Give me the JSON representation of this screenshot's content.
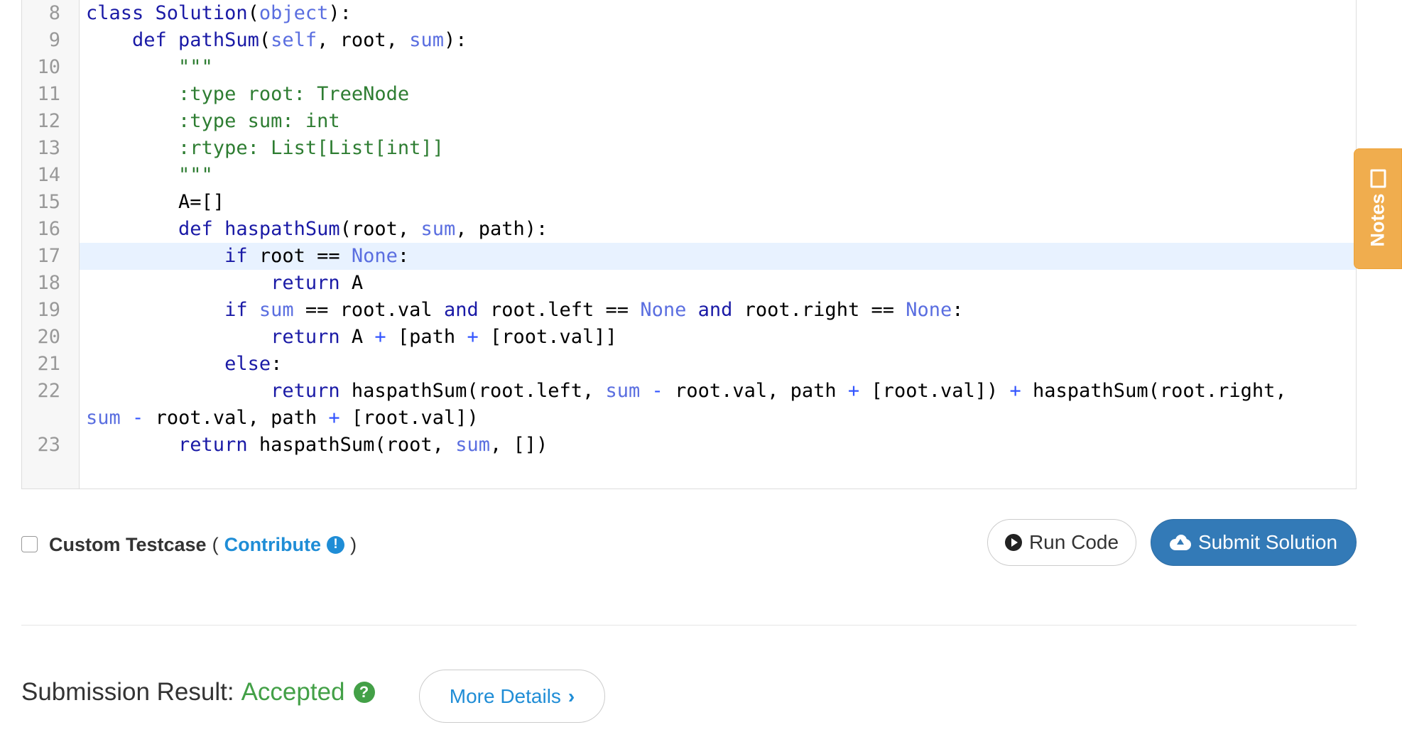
{
  "editor": {
    "lines": [
      {
        "num": "8",
        "segs": [
          [
            "class ",
            "kw"
          ],
          [
            "Solution",
            "kw"
          ],
          [
            "(",
            ""
          ],
          [
            "object",
            "vr"
          ],
          [
            "):",
            ""
          ]
        ]
      },
      {
        "num": "9",
        "segs": [
          [
            "    def ",
            "kw"
          ],
          [
            "pathSum",
            "kw"
          ],
          [
            "(",
            ""
          ],
          [
            "self",
            "vr"
          ],
          [
            ", root, ",
            ""
          ],
          [
            "sum",
            "vr"
          ],
          [
            "):",
            ""
          ]
        ]
      },
      {
        "num": "10",
        "segs": [
          [
            "        \"\"\"",
            "st"
          ]
        ]
      },
      {
        "num": "11",
        "segs": [
          [
            "        :type root: TreeNode",
            "st"
          ]
        ]
      },
      {
        "num": "12",
        "segs": [
          [
            "        :type sum: int",
            "st"
          ]
        ]
      },
      {
        "num": "13",
        "segs": [
          [
            "        :rtype: List[List[int]]",
            "st"
          ]
        ]
      },
      {
        "num": "14",
        "segs": [
          [
            "        \"\"\"",
            "st"
          ]
        ]
      },
      {
        "num": "15",
        "segs": [
          [
            "        A=[]",
            ""
          ]
        ]
      },
      {
        "num": "16",
        "segs": [
          [
            "        def ",
            "kw"
          ],
          [
            "haspathSum",
            "kw"
          ],
          [
            "(root, ",
            ""
          ],
          [
            "sum",
            "vr"
          ],
          [
            ", path):",
            ""
          ]
        ]
      },
      {
        "num": "17",
        "active": true,
        "segs": [
          [
            "            if ",
            "kw"
          ],
          [
            "root == ",
            ""
          ],
          [
            "None",
            "vr"
          ],
          [
            ":",
            ""
          ]
        ]
      },
      {
        "num": "18",
        "segs": [
          [
            "                return ",
            "kw"
          ],
          [
            "A",
            ""
          ]
        ]
      },
      {
        "num": "19",
        "segs": [
          [
            "            if ",
            "kw"
          ],
          [
            "sum",
            "vr"
          ],
          [
            " == root.val ",
            ""
          ],
          [
            "and",
            "kw"
          ],
          [
            " root.left == ",
            ""
          ],
          [
            "None",
            "vr"
          ],
          [
            " ",
            ""
          ],
          [
            "and",
            "kw"
          ],
          [
            " root.right == ",
            ""
          ],
          [
            "None",
            "vr"
          ],
          [
            ":",
            ""
          ]
        ]
      },
      {
        "num": "20",
        "segs": [
          [
            "                return ",
            "kw"
          ],
          [
            "A ",
            ""
          ],
          [
            "+",
            "op"
          ],
          [
            " [path ",
            ""
          ],
          [
            "+",
            "op"
          ],
          [
            " [root.val]]",
            ""
          ]
        ]
      },
      {
        "num": "21",
        "segs": [
          [
            "            else",
            "kw"
          ],
          [
            ":",
            ""
          ]
        ]
      },
      {
        "num": "22",
        "segs": [
          [
            "                return ",
            "kw"
          ],
          [
            "haspathSum(root.left, ",
            ""
          ],
          [
            "sum",
            "vr"
          ],
          [
            " ",
            ""
          ],
          [
            "-",
            "op"
          ],
          [
            " root.val, path ",
            ""
          ],
          [
            "+",
            "op"
          ],
          [
            " [root.val]) ",
            ""
          ],
          [
            "+",
            "op"
          ],
          [
            " haspathSum(root.right,",
            ""
          ]
        ]
      },
      {
        "num": "",
        "segs": [
          [
            "sum",
            "vr"
          ],
          [
            " ",
            ""
          ],
          [
            "-",
            "op"
          ],
          [
            " root.val, path ",
            ""
          ],
          [
            "+",
            "op"
          ],
          [
            " [root.val])",
            ""
          ]
        ]
      },
      {
        "num": "23",
        "segs": [
          [
            "        return ",
            "kw"
          ],
          [
            "haspathSum(root, ",
            ""
          ],
          [
            "sum",
            "vr"
          ],
          [
            ", [])",
            ""
          ]
        ]
      }
    ]
  },
  "notes": {
    "label": "Notes"
  },
  "testcase": {
    "label": "Custom Testcase",
    "open_paren": "(",
    "contribute": "Contribute",
    "info_glyph": "!",
    "close_paren": ")"
  },
  "actions": {
    "run_label": "Run Code",
    "submit_label": "Submit Solution"
  },
  "result": {
    "label": "Submission Result:",
    "status": "Accepted",
    "help_glyph": "?",
    "details_label": "More Details",
    "details_chevron": "›"
  },
  "colors": {
    "accent_blue": "#337ab7",
    "link_blue": "#1f8dd6",
    "success_green": "#43a047",
    "notes_orange": "#f0ad4e"
  }
}
